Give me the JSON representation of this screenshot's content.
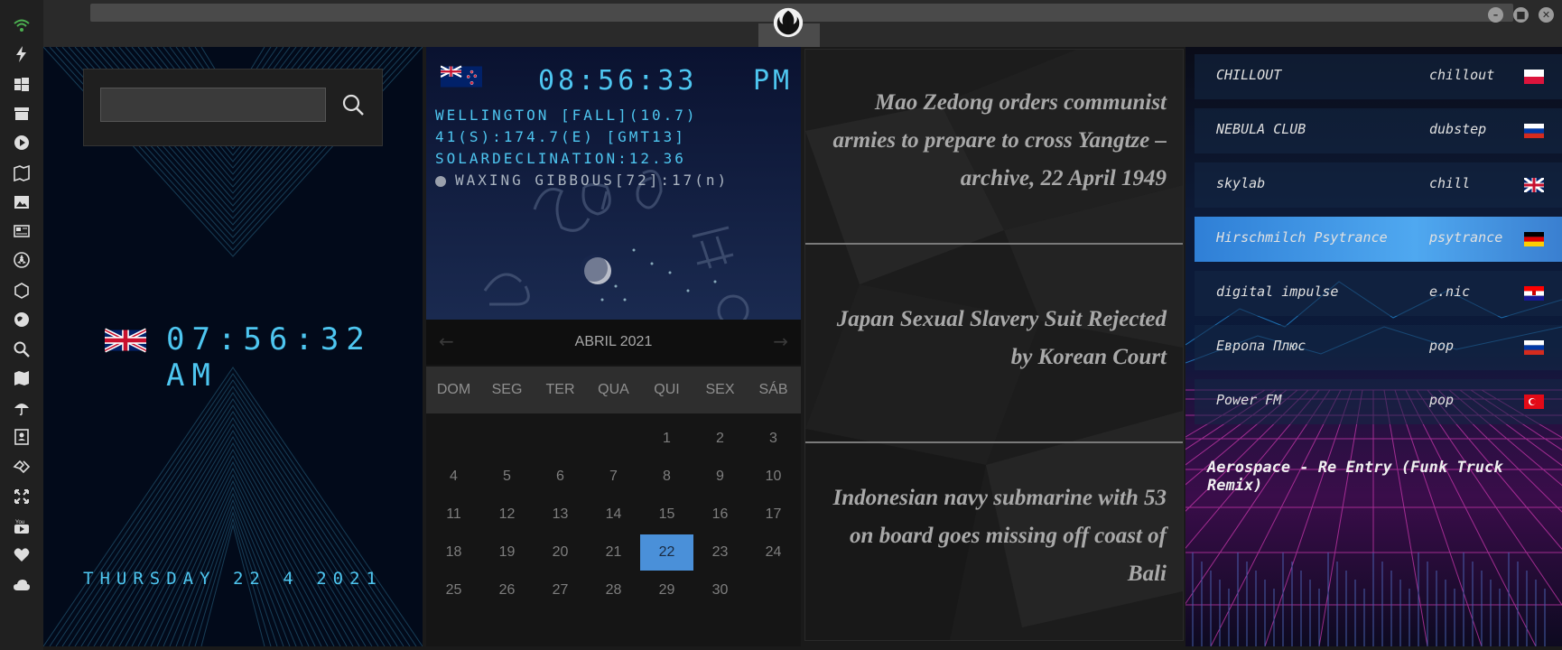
{
  "sidebar": {
    "icons": [
      "wifi-icon",
      "lightning-icon",
      "windows-icon",
      "archive-icon",
      "play-icon",
      "map-book-icon",
      "image-icon",
      "news-icon",
      "radiation-icon",
      "hexagon-icon",
      "globe-icon",
      "search-icon",
      "map-icon",
      "umbrella-icon",
      "contacts-icon",
      "tag-icon",
      "expand-icon",
      "youtube-icon",
      "heart-icon",
      "cloud-icon"
    ],
    "accent": "#4caf50"
  },
  "window": {
    "logo": "rebel-alliance-icon",
    "minimize": "–",
    "maximize": "■",
    "close": "✕"
  },
  "search": {
    "value": "",
    "placeholder": ""
  },
  "clock": {
    "flag": "uk-flag-icon",
    "time": "07:56:32 AM",
    "date": "THURSDAY 22 4 2021",
    "color": "#4ec6f0"
  },
  "astro": {
    "flag": "new-zealand-flag-icon",
    "time": "08:56:33",
    "ampm": "PM",
    "line1": "WELLINGTON [FALL](10.7)",
    "line2": "41(S):174.7(E) [GMT13]",
    "line3": "SOLARDECLINATION:12.36",
    "moon": "WAXING GIBBOUS[72]:17(n)"
  },
  "calendar": {
    "month": "ABRIL 2021",
    "prev": "←",
    "next": "→",
    "days_of_week": [
      "DOM",
      "SEG",
      "TER",
      "QUA",
      "QUI",
      "SEX",
      "SÁB"
    ],
    "first_weekday": 4,
    "days_in_month": 30,
    "today": 22,
    "today_color": "#4a90d9"
  },
  "news": [
    "Mao Zedong orders communist armies to prepare to cross Yangtze – archive, 22 April 1949",
    "Japan Sexual Slavery Suit Rejected by Korean Court",
    "Indonesian navy submarine with 53 on board goes missing off coast of Bali"
  ],
  "radio": {
    "stations": [
      {
        "name": "CHILLOUT",
        "genre": "chillout",
        "flag": "poland-flag-icon",
        "active": false
      },
      {
        "name": "NEBULA CLUB",
        "genre": "dubstep",
        "flag": "russia-flag-icon",
        "active": false
      },
      {
        "name": "skylab",
        "genre": "chill",
        "flag": "uk-flag-icon",
        "active": false
      },
      {
        "name": "Hirschmilch Psytrance",
        "genre": "psytrance",
        "flag": "germany-flag-icon",
        "active": true
      },
      {
        "name": "digital impulse",
        "genre": "e.nic",
        "flag": "croatia-flag-icon",
        "active": false
      },
      {
        "name": "Европа Плюс",
        "genre": "pop",
        "flag": "russia-flag-icon",
        "active": false
      },
      {
        "name": "Power FM",
        "genre": "pop",
        "flag": "turkey-flag-icon",
        "active": false
      }
    ],
    "now_playing": "Aerospace - Re Entry (Funk Truck Remix)",
    "active_color": "#2f7fd6"
  }
}
